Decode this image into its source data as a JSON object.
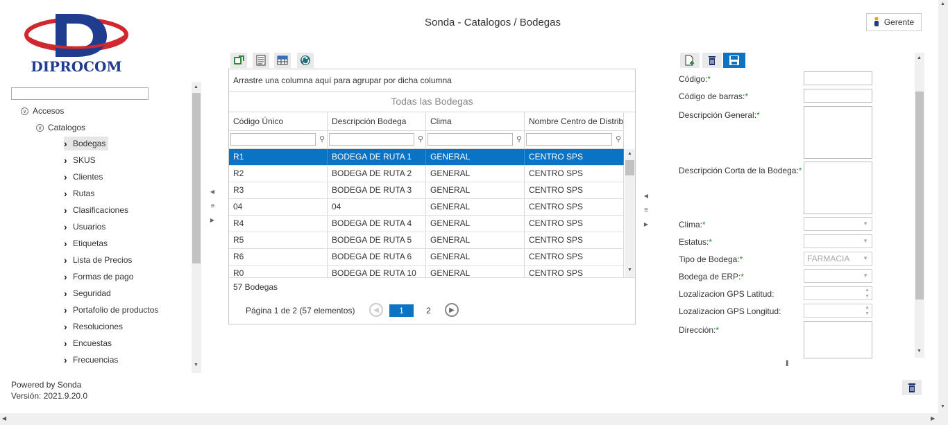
{
  "header": {
    "logo_text": "DIPROCOM",
    "title": "Sonda - Catalogos / Bodegas",
    "user_label": "Gerente",
    "user_icon": "person-icon"
  },
  "sidebar": {
    "search_value": "",
    "tree": {
      "root": "Accesos",
      "group": "Catalogos",
      "items": [
        {
          "label": "Bodegas",
          "selected": true
        },
        {
          "label": "SKUS"
        },
        {
          "label": "Clientes"
        },
        {
          "label": "Rutas"
        },
        {
          "label": "Clasificaciones"
        },
        {
          "label": "Usuarios"
        },
        {
          "label": "Etiquetas"
        },
        {
          "label": "Lista de Precios"
        },
        {
          "label": "Formas de pago"
        },
        {
          "label": "Seguridad"
        },
        {
          "label": "Portafolio de productos"
        },
        {
          "label": "Resoluciones"
        },
        {
          "label": "Encuestas"
        },
        {
          "label": "Frecuencias"
        }
      ]
    },
    "footer": {
      "powered": "Powered by Sonda",
      "version": "Versión: 2021.9.20.0"
    }
  },
  "grid": {
    "toolbar_icons": [
      "export-icon",
      "report-icon",
      "columns-icon",
      "refresh-icon"
    ],
    "group_panel_text": "Arrastre una columna aquí para agrupar por dicha columna",
    "caption": "Todas las Bodegas",
    "columns": [
      "Código Único",
      "Descripción Bodega",
      "Clima",
      "Nombre Centro de Distrib"
    ],
    "rows": [
      [
        "R1",
        "BODEGA DE RUTA 1",
        "GENERAL",
        "CENTRO SPS"
      ],
      [
        "R2",
        "BODEGA DE RUTA 2",
        "GENERAL",
        "CENTRO SPS"
      ],
      [
        "R3",
        "BODEGA DE RUTA 3",
        "GENERAL",
        "CENTRO SPS"
      ],
      [
        "04",
        "04",
        "GENERAL",
        "CENTRO SPS"
      ],
      [
        "R4",
        "BODEGA DE RUTA 4",
        "GENERAL",
        "CENTRO SPS"
      ],
      [
        "R5",
        "BODEGA DE RUTA 5",
        "GENERAL",
        "CENTRO SPS"
      ],
      [
        "R6",
        "BODEGA DE RUTA 6",
        "GENERAL",
        "CENTRO SPS"
      ],
      [
        "R0",
        "BODEGA DE RUTA 10",
        "GENERAL",
        "CENTRO SPS"
      ]
    ],
    "selected_row": 0,
    "total_text": "57 Bodegas",
    "pager": {
      "summary": "Página 1 de 2 (57 elementos)",
      "pages": [
        "1",
        "2"
      ],
      "current": "1"
    }
  },
  "form": {
    "toolbar_icons": [
      "new-icon",
      "delete-icon",
      "save-icon"
    ],
    "fields": {
      "codigo": {
        "label": "Código:",
        "req": "*",
        "value": ""
      },
      "barras": {
        "label": "Código de barras:",
        "req": "*",
        "value": ""
      },
      "desc_general": {
        "label": "Descripción General:",
        "req": "*",
        "value": ""
      },
      "desc_corta": {
        "label": "Descripción Corta de la Bodega:",
        "req": "*",
        "value": ""
      },
      "clima": {
        "label": "Clima:",
        "req": "*",
        "value": ""
      },
      "estatus": {
        "label": "Estatus:",
        "req": "*",
        "value": ""
      },
      "tipo": {
        "label": "Tipo de Bodega:",
        "req": "*",
        "value": "FARMACIA"
      },
      "erp": {
        "label": "Bodega de ERP:",
        "req": "*",
        "value": ""
      },
      "lat": {
        "label": "Lozalizacion GPS Latitud:",
        "value": ""
      },
      "lon": {
        "label": "Lozalizacion GPS Longitud:",
        "value": ""
      },
      "direccion": {
        "label": "Dirección:",
        "req": "*",
        "value": ""
      }
    },
    "bottom_icon": "delete-icon"
  },
  "colors": {
    "accent": "#0a73c3",
    "logo_red": "#d0282e",
    "logo_blue": "#1f3c8f",
    "required": "#2a8a2a"
  }
}
